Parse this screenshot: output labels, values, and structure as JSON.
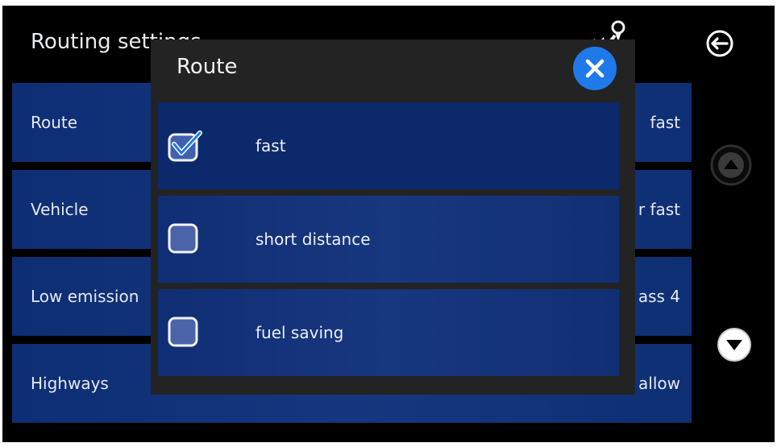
{
  "header": {
    "title": "Routing settings"
  },
  "settings": [
    {
      "label": "Route",
      "value": "fast"
    },
    {
      "label": "Vehicle",
      "value": "r fast"
    },
    {
      "label": "Low emission",
      "value": "ass 4"
    },
    {
      "label": "Highways",
      "value": "allow"
    }
  ],
  "dialog": {
    "title": "Route",
    "options": [
      {
        "label": "fast",
        "checked": true
      },
      {
        "label": "short distance",
        "checked": false
      },
      {
        "label": "fuel saving",
        "checked": false
      }
    ]
  },
  "icons": {
    "back": "arrow-left-circle-icon",
    "close": "close-circle-icon",
    "scroll_up": "chevron-up-circle-icon",
    "scroll_down": "chevron-down-circle-icon",
    "route": "route-map-icon",
    "checkbox": "checkbox-icon"
  },
  "colors": {
    "background": "#000000",
    "row_blue": "#16367f",
    "dialog_bg": "#232323",
    "accent": "#1f79e8",
    "text": "#e6e9ef"
  }
}
